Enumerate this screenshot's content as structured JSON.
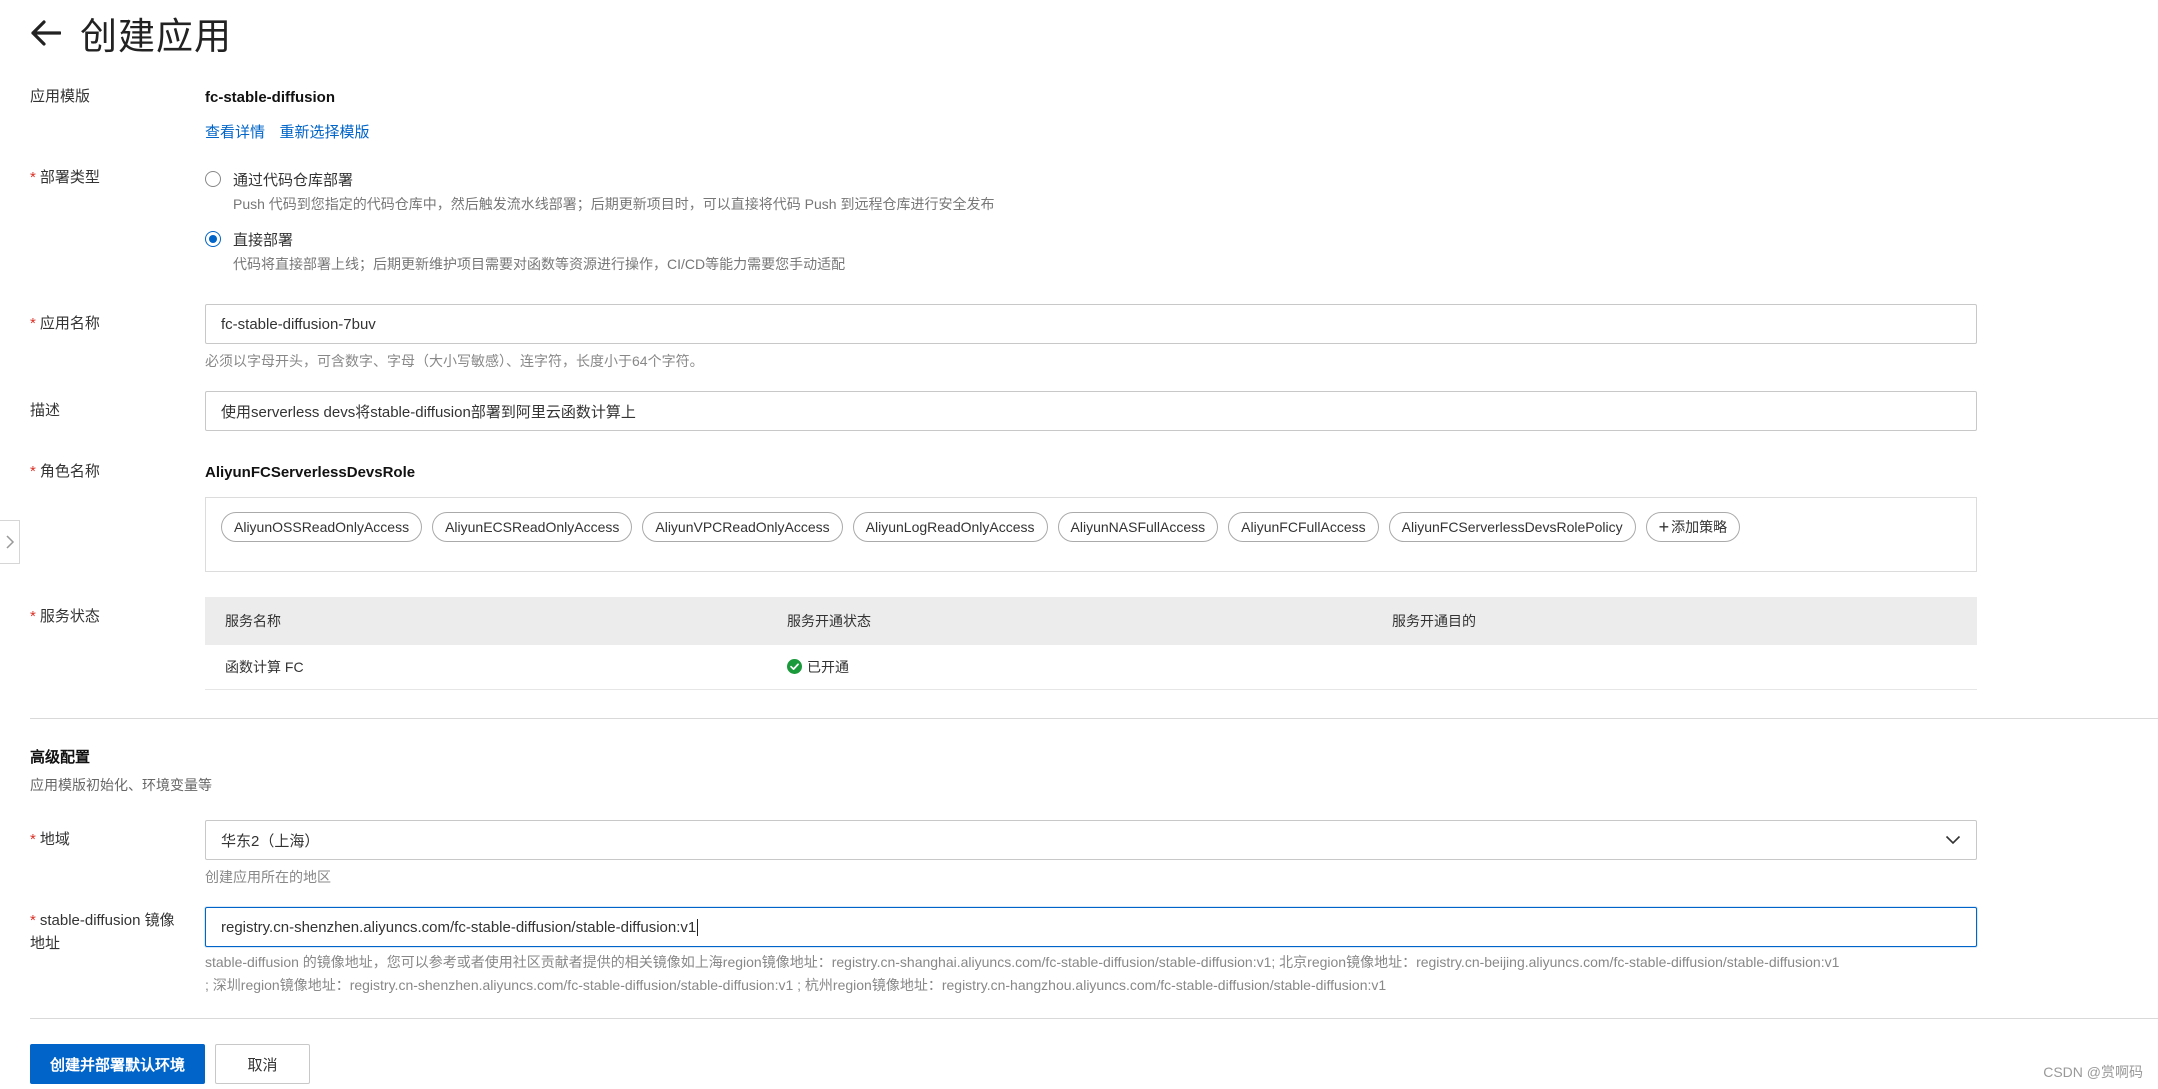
{
  "header": {
    "title": "创建应用"
  },
  "template": {
    "label": "应用模版",
    "name": "fc-stable-diffusion",
    "view_details": "查看详情",
    "reselect": "重新选择模版"
  },
  "deploy_type": {
    "label": "部署类型",
    "options": [
      {
        "label": "通过代码仓库部署",
        "desc": "Push 代码到您指定的代码仓库中，然后触发流水线部署；后期更新项目时，可以直接将代码 Push 到远程仓库进行安全发布",
        "checked": false
      },
      {
        "label": "直接部署",
        "desc": "代码将直接部署上线；后期更新维护项目需要对函数等资源进行操作，CI/CD等能力需要您手动适配",
        "checked": true
      }
    ]
  },
  "app_name": {
    "label": "应用名称",
    "value": "fc-stable-diffusion-7buv",
    "help": "必须以字母开头，可含数字、字母（大小写敏感）、连字符，长度小于64个字符。"
  },
  "description": {
    "label": "描述",
    "value": "使用serverless devs将stable-diffusion部署到阿里云函数计算上"
  },
  "role": {
    "label": "角色名称",
    "name": "AliyunFCServerlessDevsRole",
    "policies": [
      "AliyunOSSReadOnlyAccess",
      "AliyunECSReadOnlyAccess",
      "AliyunVPCReadOnlyAccess",
      "AliyunLogReadOnlyAccess",
      "AliyunNASFullAccess",
      "AliyunFCFullAccess",
      "AliyunFCServerlessDevsRolePolicy"
    ],
    "add_policy": "添加策略"
  },
  "service_status": {
    "label": "服务状态",
    "columns": [
      "服务名称",
      "服务开通状态",
      "服务开通目的"
    ],
    "rows": [
      {
        "name": "函数计算 FC",
        "status": "已开通",
        "purpose": ""
      }
    ],
    "status_color": "#1a9a3b"
  },
  "advanced": {
    "title": "高级配置",
    "subtitle": "应用模版初始化、环境变量等"
  },
  "region": {
    "label": "地域",
    "value": "华东2（上海）",
    "help": "创建应用所在的地区"
  },
  "image": {
    "label_line1": "stable-diffusion 镜像",
    "label_line2": "地址",
    "value": "registry.cn-shenzhen.aliyuncs.com/fc-stable-diffusion/stable-diffusion:v1",
    "help_line1": "stable-diffusion 的镜像地址，您可以参考或者使用社区贡献者提供的相关镜像如上海region镜像地址：registry.cn-shanghai.aliyuncs.com/fc-stable-diffusion/stable-diffusion:v1; 北京region镜像地址：registry.cn-beijing.aliyuncs.com/fc-stable-diffusion/stable-diffusion:v1",
    "help_line2": "; 深圳region镜像地址：registry.cn-shenzhen.aliyuncs.com/fc-stable-diffusion/stable-diffusion:v1 ; 杭州region镜像地址：registry.cn-hangzhou.aliyuncs.com/fc-stable-diffusion/stable-diffusion:v1"
  },
  "actions": {
    "submit": "创建并部署默认环境",
    "cancel": "取消"
  },
  "watermark": "CSDN @赏啊码",
  "colors": {
    "primary": "#0064c8",
    "required": "#d93026"
  }
}
